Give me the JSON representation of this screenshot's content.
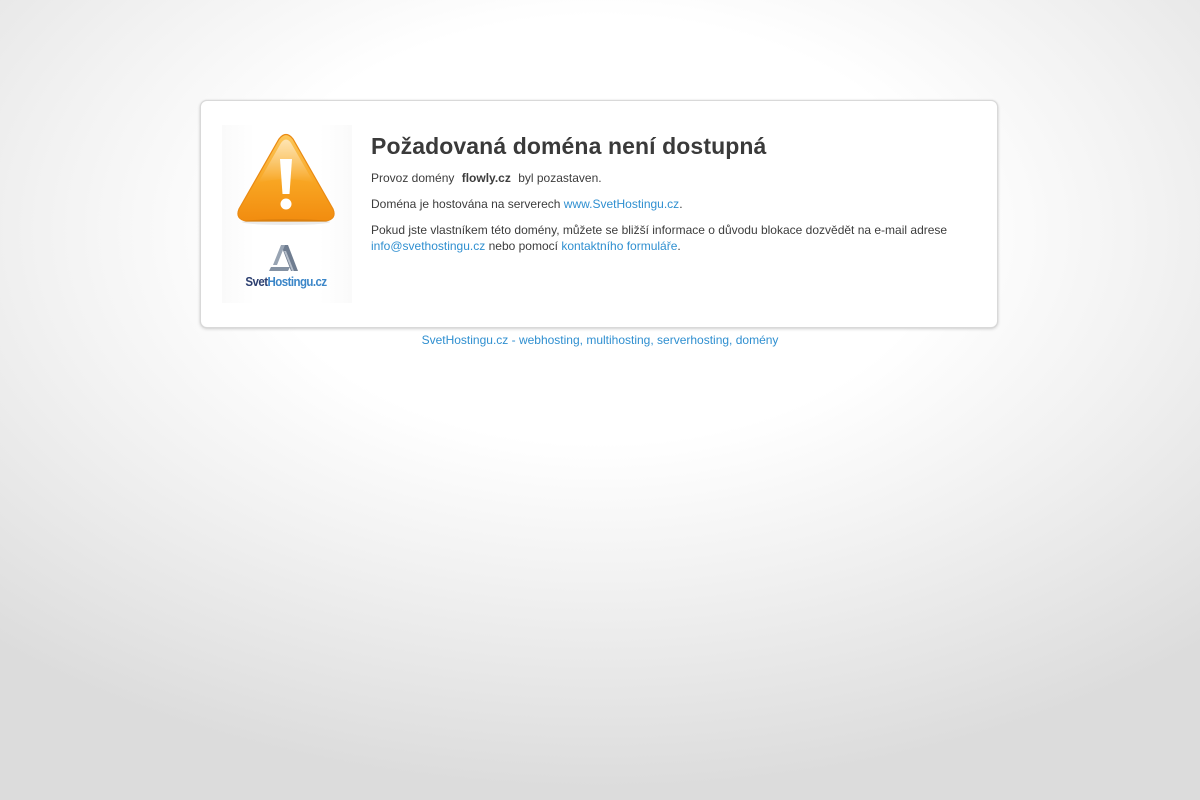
{
  "message": {
    "title": "Požadovaná doména není dostupná",
    "line1_prefix": "Provoz domény",
    "domain": "flowly.cz",
    "line1_suffix": "byl pozastaven.",
    "line2_prefix": "Doména je hostována na serverech",
    "hosting_link": "www.SvetHostingu.cz",
    "line2_suffix": ".",
    "line3_text": "Pokud jste vlastníkem této domény, můžete se bližší informace o důvodu blokace dozvědět na e-mail adrese",
    "email_link": "info@svethostingu.cz",
    "line3_middle": "nebo pomocí",
    "form_link": "kontaktního formuláře",
    "line3_suffix": "."
  },
  "brand": {
    "name_part1": "Svet",
    "name_part2": "Hostingu.cz",
    "color_dark": "#2c3f70",
    "color_light": "#3b86c8"
  },
  "icons": {
    "warning": "warning-icon",
    "brand_mark": "svethostingu-logo-icon"
  },
  "footer": {
    "link_text": "SvetHostingu.cz - webhosting, multihosting, serverhosting, domény"
  },
  "colors": {
    "link": "#2f8fd0",
    "warning_orange": "#f7a21b",
    "text": "#3c3c3c"
  }
}
